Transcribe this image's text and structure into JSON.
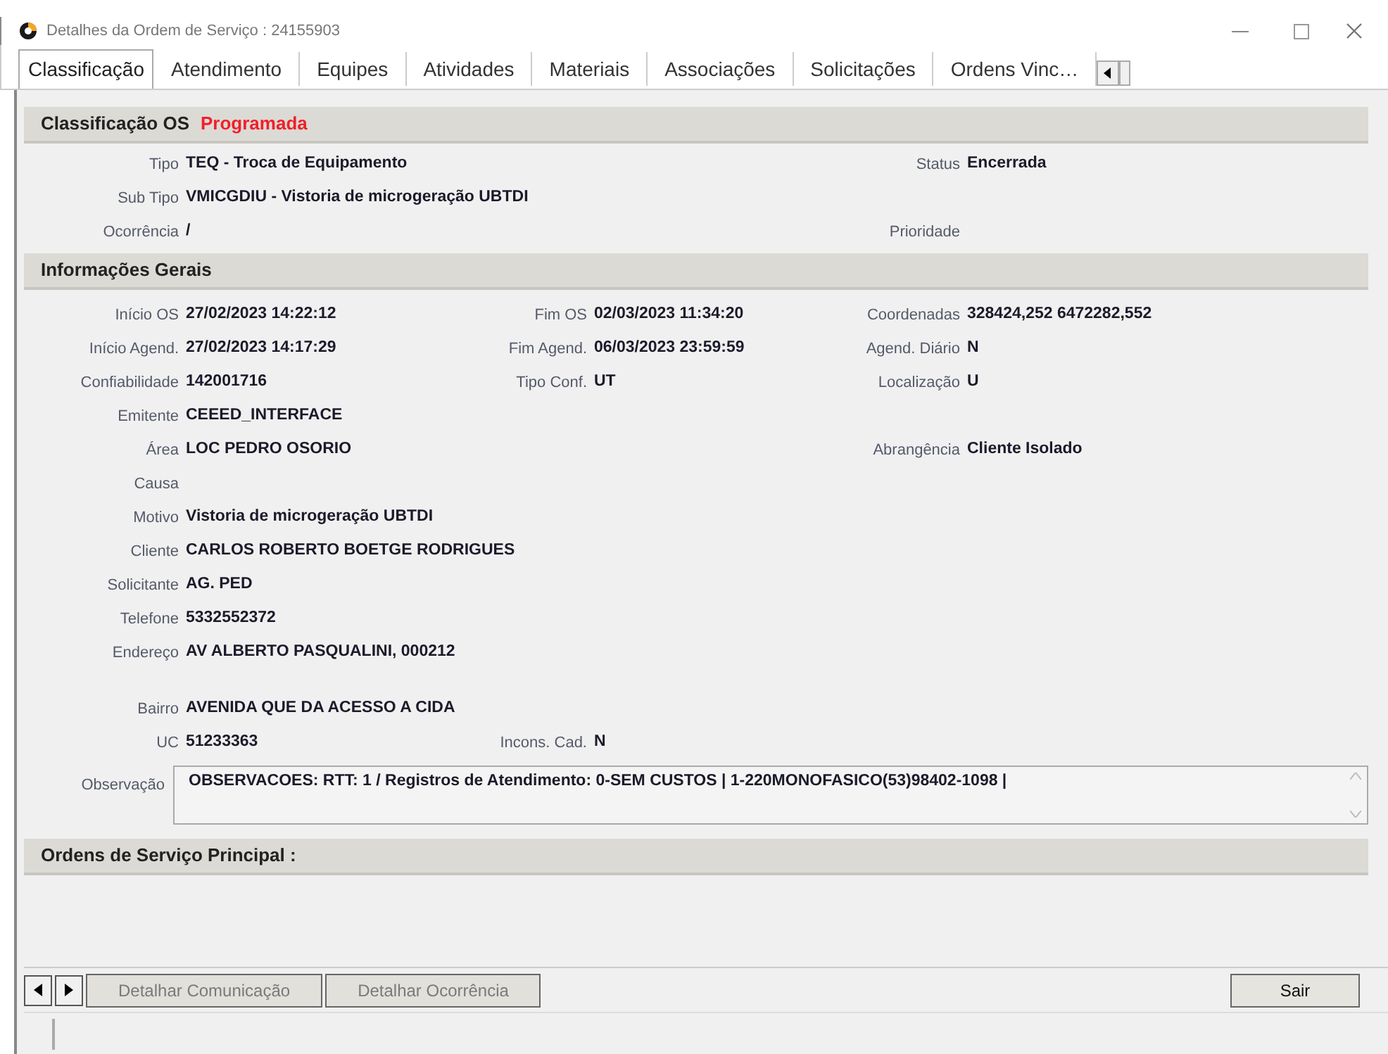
{
  "window": {
    "title": "Detalhes da Ordem de Serviço : 24155903"
  },
  "tabs": [
    {
      "label": "Classificação",
      "selected": true
    },
    {
      "label": "Atendimento",
      "selected": false
    },
    {
      "label": "Equipes",
      "selected": false
    },
    {
      "label": "Atividades",
      "selected": false
    },
    {
      "label": "Materiais",
      "selected": false
    },
    {
      "label": "Associações",
      "selected": false
    },
    {
      "label": "Solicitações",
      "selected": false
    },
    {
      "label": "Ordens Vinc…",
      "selected": false
    }
  ],
  "classificacao": {
    "title": "Classificação OS",
    "state": "Programada",
    "rows": [
      {
        "left": {
          "label": "Tipo",
          "value": "TEQ - Troca de Equipamento"
        },
        "right": {
          "label": "Status",
          "value": "Encerrada"
        }
      },
      {
        "left": {
          "label": "Sub Tipo",
          "value": "VMICGDIU - Vistoria de microgeração UBTDI"
        }
      },
      {
        "left": {
          "label": "Ocorrência",
          "value": "/"
        },
        "right": {
          "label": "Prioridade"
        }
      }
    ]
  },
  "informacoes": {
    "title": "Informações Gerais",
    "rows": [
      {
        "left": {
          "label": "Início OS",
          "value": "27/02/2023 14:22:12"
        },
        "middle": {
          "label": "Fim OS",
          "value": "02/03/2023 11:34:20"
        },
        "right": {
          "label": "Coordenadas",
          "value": "328424,252   6472282,552"
        }
      },
      {
        "left": {
          "label": "Início Agend.",
          "value": "27/02/2023 14:17:29"
        },
        "middle": {
          "label": "Fim Agend.",
          "value": "06/03/2023 23:59:59"
        },
        "right": {
          "label": "Agend. Diário",
          "value": "N"
        }
      },
      {
        "left": {
          "label": "Confiabilidade",
          "value": "142001716"
        },
        "middle": {
          "label": "Tipo Conf.",
          "value": "UT"
        },
        "right": {
          "label": "Localização",
          "value": "U"
        }
      },
      {
        "left": {
          "label": "Emitente",
          "value": "CEEED_INTERFACE"
        }
      },
      {
        "left": {
          "label": "Área",
          "value": "LOC PEDRO OSORIO"
        },
        "right": {
          "label": "Abrangência",
          "value": "Cliente Isolado"
        }
      },
      {
        "left": {
          "label": "Causa"
        }
      },
      {
        "left": {
          "label": "Motivo",
          "value": "Vistoria de microgeração UBTDI"
        }
      },
      {
        "left": {
          "label": "Cliente",
          "value": "CARLOS ROBERTO BOETGE RODRIGUES"
        }
      },
      {
        "left": {
          "label": "Solicitante",
          "value": "AG. PED"
        }
      },
      {
        "left": {
          "label": "Telefone",
          "value": "5332552372"
        }
      },
      {
        "left": {
          "label": "Endereço",
          "value": "AV ALBERTO PASQUALINI, 000212"
        }
      }
    ],
    "location_rows": [
      {
        "left": {
          "label": "Bairro",
          "value": "AVENIDA QUE DA ACESSO A CIDA"
        }
      },
      {
        "left": {
          "label": "UC",
          "value": "51233363"
        },
        "middle": {
          "label": "Incons. Cad.",
          "value": "N"
        }
      }
    ],
    "observacao": {
      "label": "Observação",
      "value": "OBSERVACOES: RTT: 1 / Registros de Atendimento: 0-SEM CUSTOS | 1-220MONOFASICO(53)98402-1098 |"
    }
  },
  "ordens_principal": {
    "title": "Ordens de Serviço Principal :"
  },
  "buttons": [
    {
      "kind": "prev"
    },
    {
      "kind": "next"
    },
    {
      "kind": "text",
      "label": "Detalhar Comunicação",
      "disabled": true
    },
    {
      "kind": "text",
      "label": "Detalhar Ocorrência",
      "disabled": true
    }
  ],
  "exit_button": {
    "label": "Sair"
  }
}
